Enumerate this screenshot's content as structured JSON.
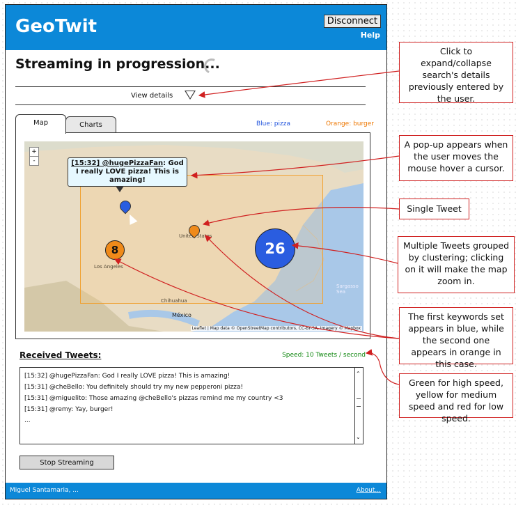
{
  "app": {
    "title": "GeoTwit",
    "disconnect_label": "Disconnect",
    "help_label": "Help"
  },
  "status": {
    "text": "Streaming in progression..."
  },
  "details": {
    "label": "View details"
  },
  "tabs": [
    {
      "label": "Map"
    },
    {
      "label": "Charts"
    }
  ],
  "legend": {
    "blue": "Blue: pizza",
    "orange": "Orange: burger"
  },
  "map": {
    "popup_text": "[15:32] @hugePizzaFan: God I really LOVE pizza! This is amazing!",
    "popup_user": "[15:32] @hugePizzaFan",
    "popup_rest": ": God I really LOVE pizza! This is amazing!",
    "cluster_orange": "8",
    "cluster_blue": "26",
    "zoom_in": "+",
    "zoom_out": "-",
    "attribution": "Leaflet | Map data © OpenStreetMap contributors, CC-BY-SA, Imagery © Mapbox",
    "labels": {
      "mexico": "México",
      "united_states": "United States",
      "sargasso": "Sargasso Sea",
      "los_angeles": "Los Angeles",
      "chihuahua": "Chihuahua"
    },
    "colors": {
      "blue": "#2a5de0",
      "orange": "#ef8a1a",
      "box": "#f0a030"
    }
  },
  "received": {
    "title": "Received Tweets:",
    "speed": "Speed: 10 Tweets / second",
    "tweets": [
      "[15:32] @hugePizzaFan: God I really LOVE pizza! This is amazing!",
      "[15:31] @cheBello: You definitely should try my new pepperoni pizza!",
      "[15:31] @miguelito: Those amazing @cheBello's pizzas remind me my country <3",
      "[15:31] @remy: Yay, burger!",
      "..."
    ]
  },
  "stop_label": "Stop Streaming",
  "footer": {
    "left": "Miguel Santamaria, ...",
    "right": "About..."
  },
  "notes": [
    "Click to expand/collapse search's details previously entered by the user.",
    "A pop-up appears when the user moves the mouse hover a cursor.",
    "Single Tweet",
    "Multiple Tweets grouped by clustering; clicking on it will make the map zoom in.",
    "The first keywords set appears in blue, while the second one appears in orange in this case.",
    "Green for high speed, yellow for medium speed and red for low speed."
  ]
}
